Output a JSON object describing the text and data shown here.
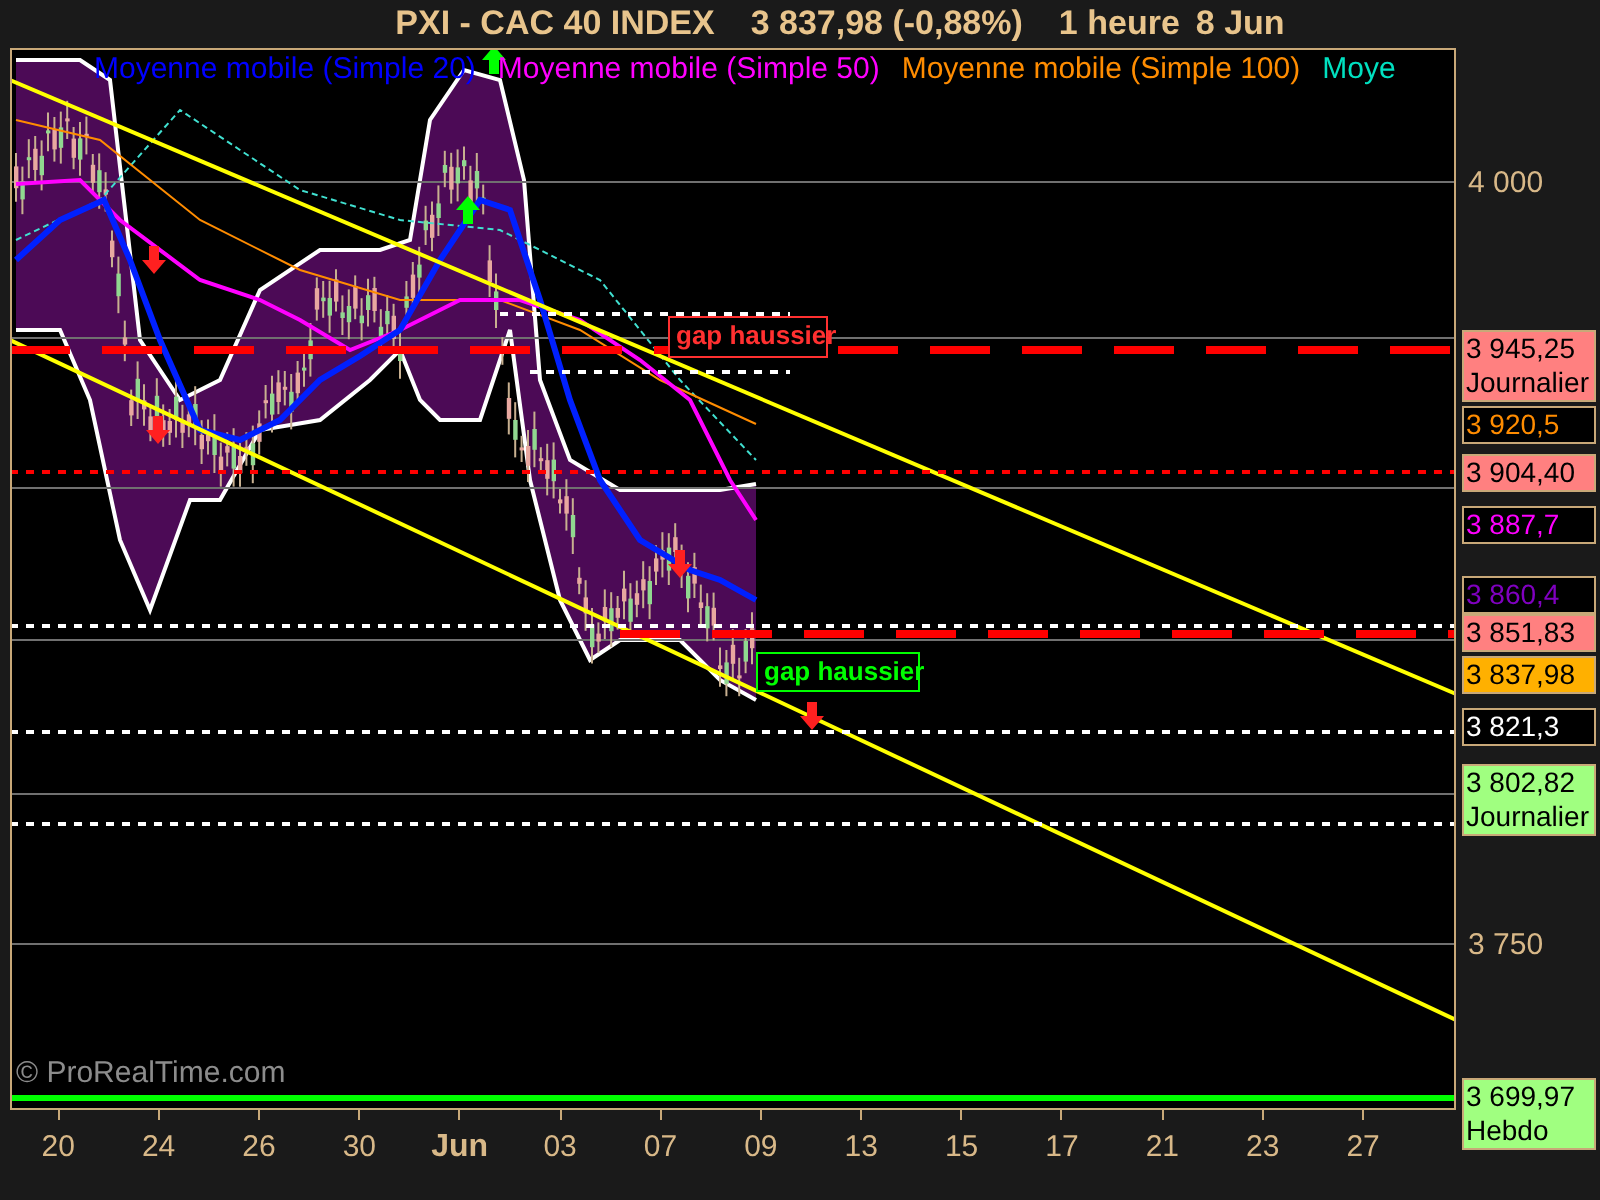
{
  "title": {
    "instrument": "PXI - CAC 40 INDEX",
    "quote": "3 837,98 (-0,88%)",
    "interval": "1 heure",
    "date": "8 Jun"
  },
  "legend": [
    {
      "label": "Moyenne mobile (Simple 20)",
      "color": "#0000ff"
    },
    {
      "label": "Moyenne mobile (Simple 50)",
      "color": "#ff00ff"
    },
    {
      "label": "Moyenne mobile (Simple 100)",
      "color": "#ff8c00"
    },
    {
      "label": "Moye",
      "color": "#00e0c0"
    }
  ],
  "annotations": [
    {
      "label": "gap haussier",
      "color": "#ff3030"
    },
    {
      "label": "gap haussier",
      "color": "#00ff00"
    }
  ],
  "credit": "© ProRealTime.com",
  "y_axis": [
    "4 000",
    "3 750"
  ],
  "price_tags": [
    {
      "value": "3 945,25",
      "note": "Journalier",
      "kind": "filled",
      "color": "#ff8080"
    },
    {
      "value": "3 920,5",
      "kind": "outlined",
      "color": "#ff8c00"
    },
    {
      "value": "3 904,40",
      "kind": "filled",
      "color": "#ff8080"
    },
    {
      "value": "3 887,7",
      "kind": "outlined",
      "color": "#ff00ff"
    },
    {
      "value": "3 860,4",
      "kind": "outlined",
      "color": "#8000c0"
    },
    {
      "value": "3 851,83",
      "kind": "filled",
      "color": "#ff8080"
    },
    {
      "value": "3 837,98",
      "kind": "filled",
      "color": "#ffb000"
    },
    {
      "value": "3 821,3",
      "kind": "outlined",
      "color": "#ffffff"
    },
    {
      "value": "3 802,82",
      "note": "Journalier",
      "kind": "filled",
      "color": "#a0ff80"
    },
    {
      "value": "3 699,97",
      "note": "Hebdo",
      "kind": "filled",
      "color": "#a0ff80"
    }
  ],
  "x_axis": [
    {
      "label": "20",
      "major": false
    },
    {
      "label": "24",
      "major": false
    },
    {
      "label": "26",
      "major": false
    },
    {
      "label": "30",
      "major": false
    },
    {
      "label": "Jun",
      "major": true
    },
    {
      "label": "03",
      "major": false
    },
    {
      "label": "07",
      "major": false
    },
    {
      "label": "09",
      "major": false
    },
    {
      "label": "13",
      "major": false
    },
    {
      "label": "15",
      "major": false
    },
    {
      "label": "17",
      "major": false
    },
    {
      "label": "21",
      "major": false
    },
    {
      "label": "23",
      "major": false
    },
    {
      "label": "27",
      "major": false
    }
  ]
}
